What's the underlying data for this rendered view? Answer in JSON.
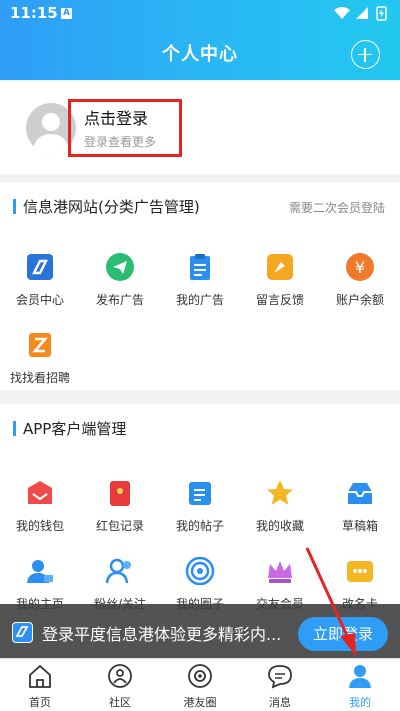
{
  "statusbar": {
    "time": "11:15",
    "notif_badge": "A"
  },
  "header": {
    "title": "个人中心"
  },
  "profile": {
    "login": "点击登录",
    "sub": "登录查看更多"
  },
  "section1": {
    "title": "信息港网站(分类广告管理)",
    "note": "需要二次会员登陆",
    "items": [
      {
        "label": "会员中心",
        "icon": "member-center-icon",
        "color": "#2a73d9"
      },
      {
        "label": "发布广告",
        "icon": "publish-ad-icon",
        "color": "#2bbd72"
      },
      {
        "label": "我的广告",
        "icon": "my-ads-icon",
        "color": "#2a8ff0"
      },
      {
        "label": "留言反馈",
        "icon": "feedback-icon",
        "color": "#f5a623"
      },
      {
        "label": "账户余额",
        "icon": "balance-icon",
        "color": "#f07a2b"
      },
      {
        "label": "找找看招聘",
        "icon": "recruit-icon",
        "color": "#f28a1e"
      }
    ]
  },
  "section2": {
    "title": "APP客户端管理",
    "items": [
      {
        "label": "我的钱包",
        "icon": "wallet-icon",
        "color": "#ee4a4a"
      },
      {
        "label": "红包记录",
        "icon": "red-packet-icon",
        "color": "#e83b3b"
      },
      {
        "label": "我的帖子",
        "icon": "my-posts-icon",
        "color": "#2a8ff0"
      },
      {
        "label": "我的收藏",
        "icon": "favorites-star-icon",
        "color": "#f5b623"
      },
      {
        "label": "草稿箱",
        "icon": "drafts-icon",
        "color": "#2a8ff0"
      },
      {
        "label": "我的主页",
        "icon": "homepage-user-icon",
        "color": "#2a8ff0"
      },
      {
        "label": "粉丝/关注",
        "icon": "fans-icon",
        "color": "#2a8ff0"
      },
      {
        "label": "我的圈子",
        "icon": "circle-icon",
        "color": "#2a8ff0"
      },
      {
        "label": "交友会员",
        "icon": "crown-icon",
        "color": "#c86be0"
      },
      {
        "label": "改名卡",
        "icon": "rename-card-icon",
        "color": "#f5b623"
      }
    ]
  },
  "banner": {
    "text": "登录平度信息港体验更多精彩内...",
    "button": "立即登录"
  },
  "tabbar": {
    "tabs": [
      {
        "label": "首页",
        "icon": "home-icon"
      },
      {
        "label": "社区",
        "icon": "community-icon"
      },
      {
        "label": "港友圈",
        "icon": "friends-circle-icon"
      },
      {
        "label": "消息",
        "icon": "message-icon"
      },
      {
        "label": "我的",
        "icon": "me-icon"
      }
    ],
    "active_index": 4
  },
  "colors": {
    "accent": "#2f9df6",
    "highlight": "#e52420"
  }
}
